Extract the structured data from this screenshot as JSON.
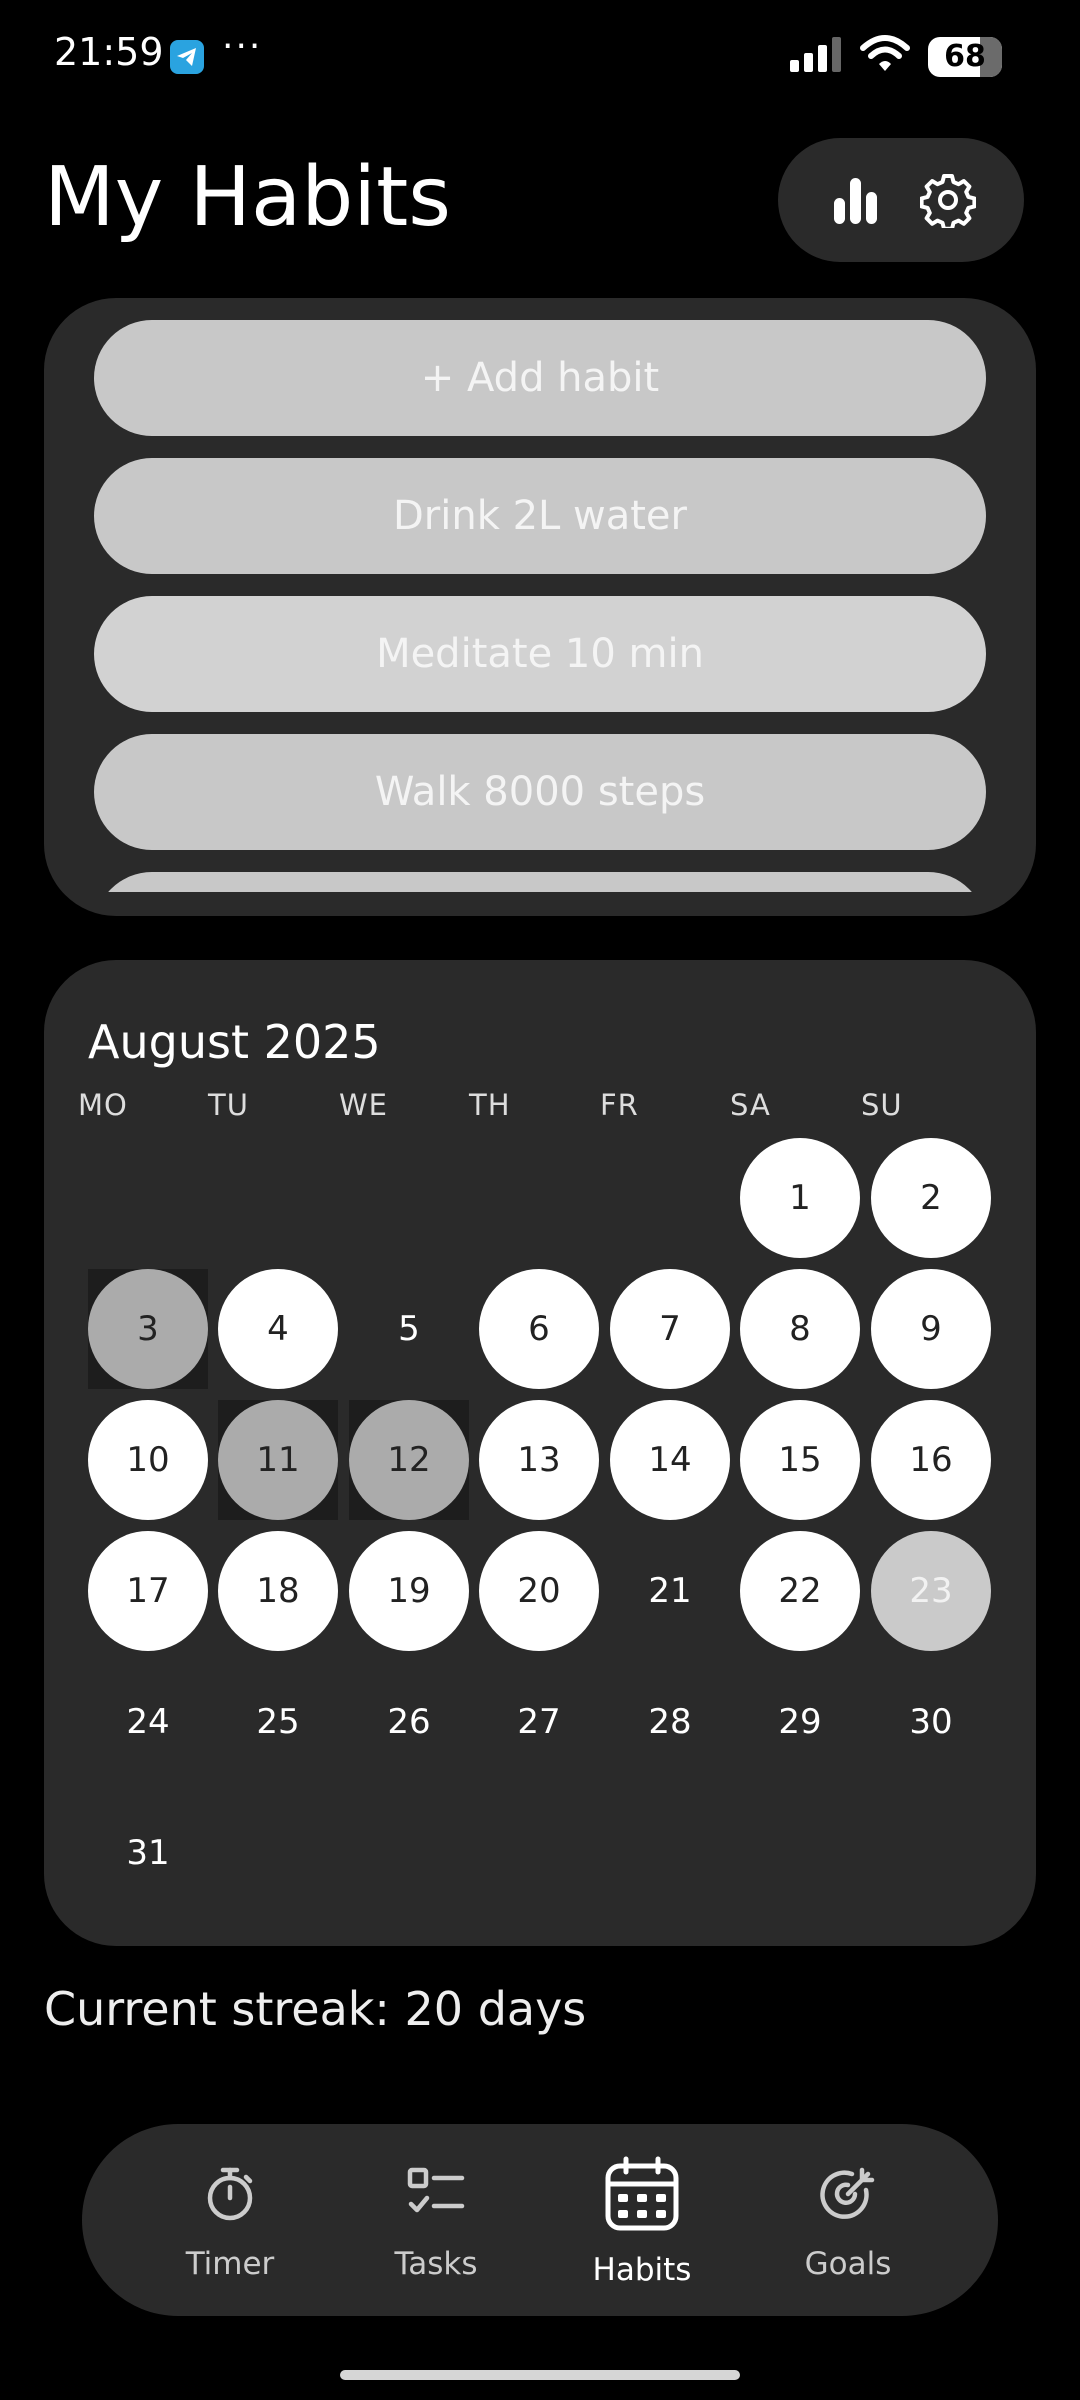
{
  "status_bar": {
    "time": "21:59",
    "dots": "···",
    "battery": "68"
  },
  "header": {
    "title": "My Habits"
  },
  "habits": [
    {
      "label": "+ Add habit"
    },
    {
      "label": "Drink 2L water"
    },
    {
      "label": "Meditate 10 min"
    },
    {
      "label": "Walk 8000 steps"
    },
    {
      "label": ""
    }
  ],
  "calendar": {
    "month": "August 2025",
    "weekdays": [
      "MO",
      "TU",
      "WE",
      "TH",
      "FR",
      "SA",
      "SU"
    ],
    "days": [
      {
        "label": "1",
        "state": "done"
      },
      {
        "label": "2",
        "state": "done"
      },
      {
        "label": "3",
        "state": "dim"
      },
      {
        "label": "4",
        "state": "done"
      },
      {
        "label": "5",
        "state": "none"
      },
      {
        "label": "6",
        "state": "done"
      },
      {
        "label": "7",
        "state": "done"
      },
      {
        "label": "8",
        "state": "done"
      },
      {
        "label": "9",
        "state": "done"
      },
      {
        "label": "10",
        "state": "done"
      },
      {
        "label": "11",
        "state": "dim"
      },
      {
        "label": "12",
        "state": "dim"
      },
      {
        "label": "13",
        "state": "done"
      },
      {
        "label": "14",
        "state": "done"
      },
      {
        "label": "15",
        "state": "done"
      },
      {
        "label": "16",
        "state": "done"
      },
      {
        "label": "17",
        "state": "done"
      },
      {
        "label": "18",
        "state": "done"
      },
      {
        "label": "19",
        "state": "done"
      },
      {
        "label": "20",
        "state": "done"
      },
      {
        "label": "21",
        "state": "none"
      },
      {
        "label": "22",
        "state": "done"
      },
      {
        "label": "23",
        "state": "today"
      },
      {
        "label": "24",
        "state": "none"
      },
      {
        "label": "25",
        "state": "none"
      },
      {
        "label": "26",
        "state": "none"
      },
      {
        "label": "27",
        "state": "none"
      },
      {
        "label": "28",
        "state": "none"
      },
      {
        "label": "29",
        "state": "none"
      },
      {
        "label": "30",
        "state": "none"
      },
      {
        "label": "31",
        "state": "none"
      }
    ]
  },
  "streak": {
    "text": "Current streak: 20 days"
  },
  "nav": [
    {
      "label": "Timer",
      "icon": "stopwatch-icon",
      "active": false
    },
    {
      "label": "Tasks",
      "icon": "checklist-icon",
      "active": false
    },
    {
      "label": "Habits",
      "icon": "calendar-icon",
      "active": true
    },
    {
      "label": "Goals",
      "icon": "target-icon",
      "active": false
    }
  ],
  "colors": {
    "background": "#000000",
    "card": "#2a2a2a",
    "habit_button": "#c8c8c8",
    "done_day": "#ffffff",
    "missed_day": "#ababab"
  }
}
